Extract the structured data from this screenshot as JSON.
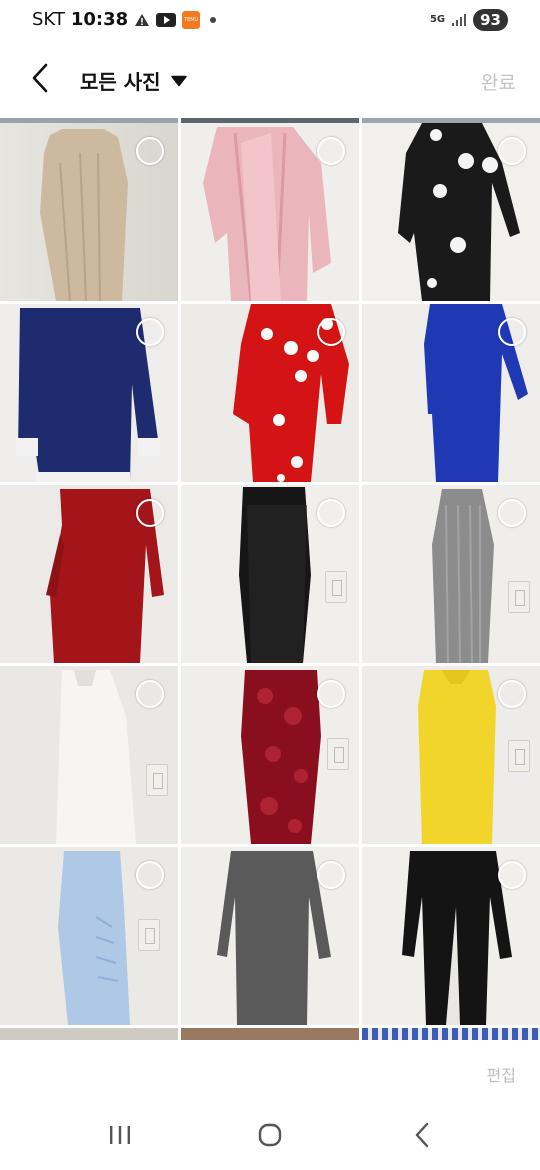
{
  "status_bar": {
    "carrier": "SKT",
    "time": "10:38",
    "notification_icons": [
      "warning-icon",
      "youtube-icon",
      "temu-icon",
      "dot-icon"
    ],
    "temu_label": "TEMU",
    "network": "5G",
    "battery": "93"
  },
  "header": {
    "back_icon": "chevron-left-icon",
    "title": "모든 사진",
    "dropdown_icon": "caret-down-icon",
    "done_label": "완료"
  },
  "grid": {
    "columns": 3,
    "photos": [
      {
        "name": "photo-beige-sleeveless-dress",
        "selected": false
      },
      {
        "name": "photo-pink-cardigan-dress",
        "selected": false
      },
      {
        "name": "photo-black-flower-dress",
        "selected": false
      },
      {
        "name": "photo-navy-longsleeve-dress",
        "selected": false
      },
      {
        "name": "photo-red-flower-dress",
        "selected": false
      },
      {
        "name": "photo-blue-longsleeve-dress",
        "selected": false
      },
      {
        "name": "photo-red-longsleeve-dress",
        "selected": false
      },
      {
        "name": "photo-black-mesh-dress",
        "selected": false
      },
      {
        "name": "photo-gray-knit-dress",
        "selected": false
      },
      {
        "name": "photo-white-sleeveless-dress",
        "selected": false
      },
      {
        "name": "photo-burgundy-velvet-dress",
        "selected": false
      },
      {
        "name": "photo-yellow-dress",
        "selected": false
      },
      {
        "name": "photo-lightblue-ruched-dress",
        "selected": false
      },
      {
        "name": "photo-gray-longsleeve-dress",
        "selected": false
      },
      {
        "name": "photo-black-slit-dress",
        "selected": false
      }
    ]
  },
  "footer": {
    "edit_label": "편집"
  },
  "nav_bar": {
    "recents_icon": "recents-icon",
    "home_icon": "home-icon",
    "back_icon": "back-icon"
  }
}
